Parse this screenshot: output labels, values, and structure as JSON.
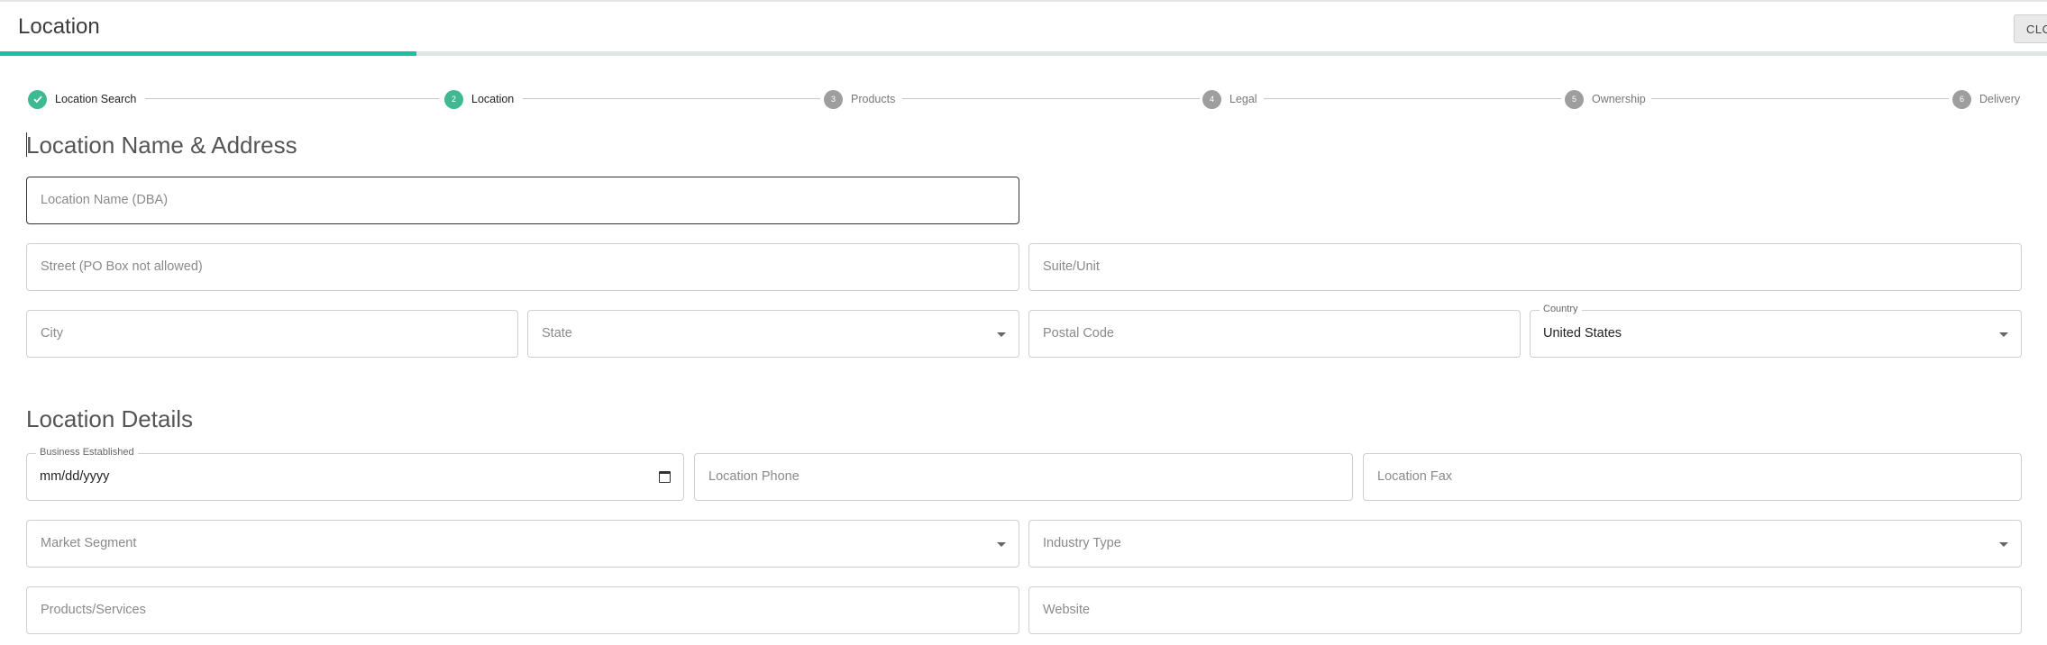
{
  "header": {
    "title": "Location",
    "close_label": "CLOSE",
    "progress_fraction": 0.2035
  },
  "stepper": {
    "steps": [
      {
        "number": "✓",
        "label": "Location Search",
        "state": "done"
      },
      {
        "number": "2",
        "label": "Location",
        "state": "active"
      },
      {
        "number": "3",
        "label": "Products",
        "state": "pending"
      },
      {
        "number": "4",
        "label": "Legal",
        "state": "pending"
      },
      {
        "number": "5",
        "label": "Ownership",
        "state": "pending"
      },
      {
        "number": "6",
        "label": "Delivery",
        "state": "pending"
      }
    ]
  },
  "address": {
    "section_title": "Location Name & Address",
    "location_name_placeholder": "Location Name (DBA)",
    "street_placeholder": "Street (PO Box not allowed)",
    "suite_placeholder": "Suite/Unit",
    "city_placeholder": "City",
    "state_placeholder": "State",
    "postal_placeholder": "Postal Code",
    "country_label": "Country",
    "country_value": "United States"
  },
  "details": {
    "section_title": "Location Details",
    "business_established_label": "Business Established",
    "business_established_value": "mm/dd/yyyy",
    "phone_placeholder": "Location Phone",
    "fax_placeholder": "Location Fax",
    "market_segment_placeholder": "Market Segment",
    "industry_type_placeholder": "Industry Type",
    "products_services_placeholder": "Products/Services",
    "website_placeholder": "Website"
  },
  "colors": {
    "accent": "#1fbfa4",
    "step_done": "#3fb991",
    "step_pending": "#9e9e9e"
  }
}
